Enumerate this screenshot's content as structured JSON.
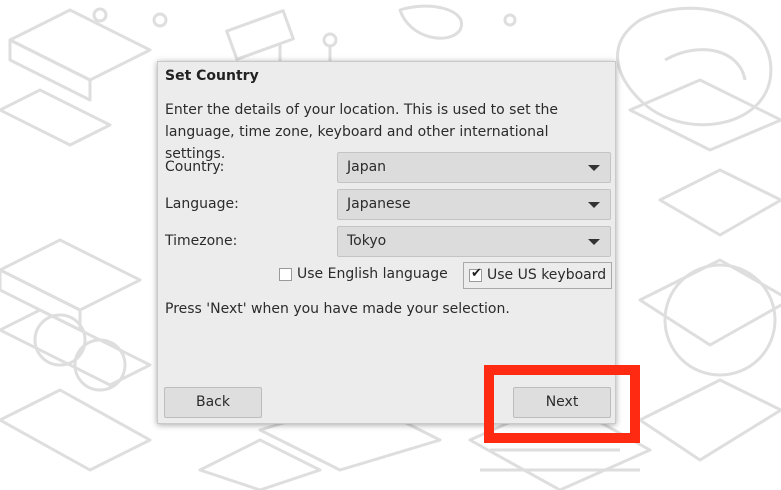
{
  "dialog": {
    "title": "Set Country",
    "description": "Enter the details of your location. This is used to set the language, time zone, keyboard and other international settings.",
    "country_label": "Country:",
    "country_value": "Japan",
    "language_label": "Language:",
    "language_value": "Japanese",
    "timezone_label": "Timezone:",
    "timezone_value": "Tokyo",
    "use_english_label": "Use English language",
    "use_english_checked": false,
    "use_us_keyboard_label": "Use US keyboard",
    "use_us_keyboard_checked": true,
    "hint": "Press 'Next' when you have made your selection.",
    "back_label": "Back",
    "next_label": "Next"
  },
  "annotation": {
    "highlight_color": "#ff2a12",
    "highlight_target": "next-button"
  },
  "colors": {
    "dialog_bg": "#ececec",
    "wallpaper_lines": "#e0e0e0"
  }
}
